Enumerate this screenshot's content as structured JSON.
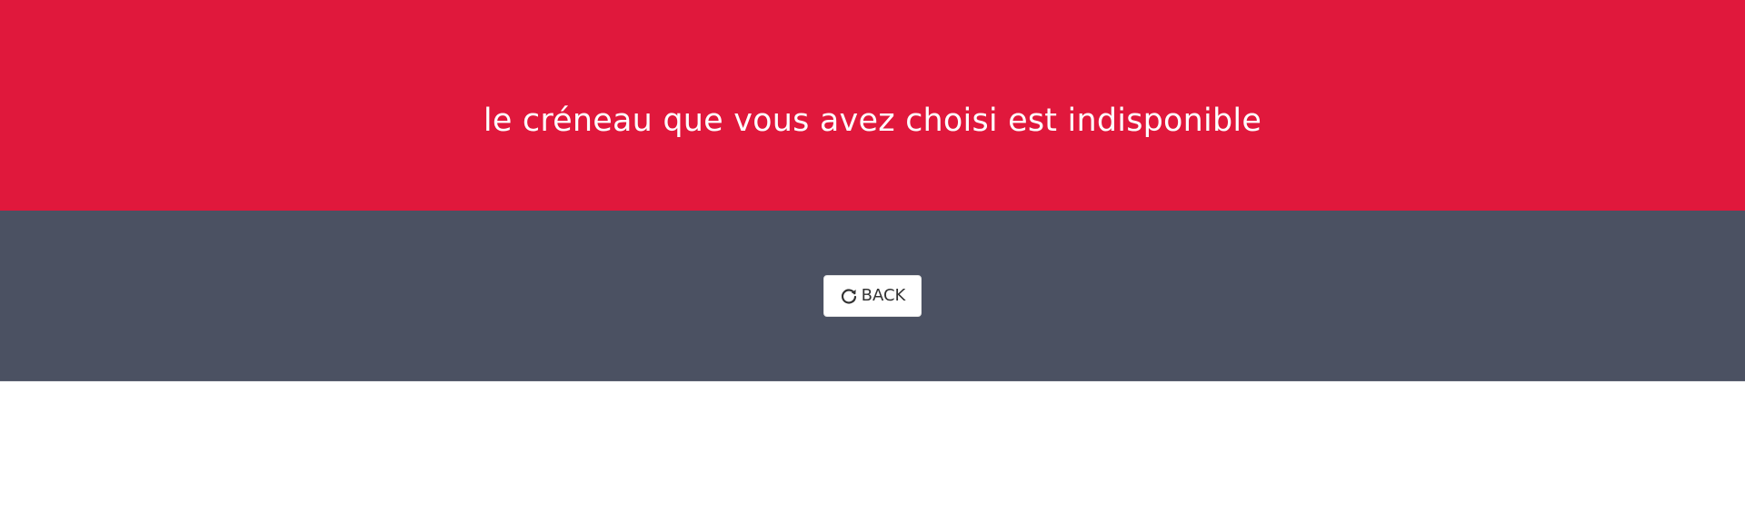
{
  "banner": {
    "message": "le créneau que vous avez choisi est indisponible",
    "background": "#e0183c",
    "text_color": "#ffffff"
  },
  "toolbar": {
    "background": "#4b5162",
    "back_button": {
      "label": "BACK",
      "icon": "refresh-icon"
    }
  }
}
